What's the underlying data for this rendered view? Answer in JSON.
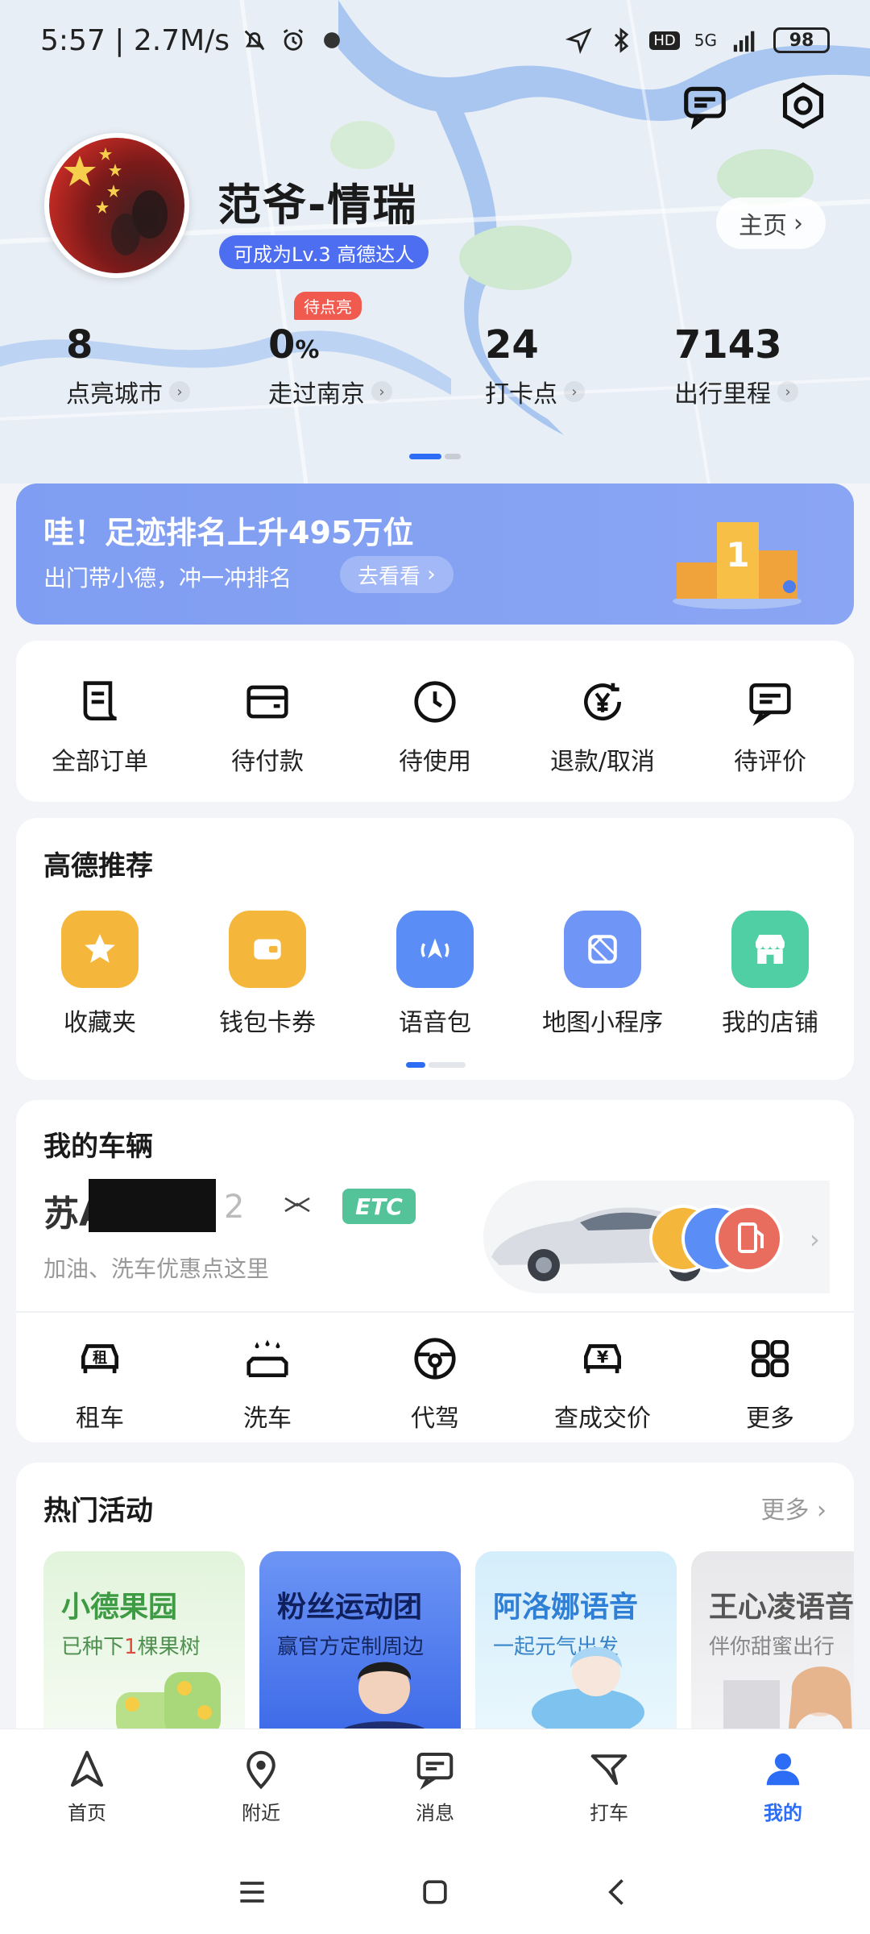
{
  "status_bar": {
    "time_speed": "5:57 | 2.7M/s",
    "network": "5G",
    "hd": "HD",
    "battery": "98"
  },
  "profile": {
    "username": "范爷-情瑞",
    "level_badge": "可成为Lv.3 高德达人",
    "home_button": "主页"
  },
  "stats": [
    {
      "value": "8",
      "unit": "",
      "label": "点亮城市"
    },
    {
      "value": "0",
      "unit": "%",
      "label": "走过南京",
      "tag": "待点亮"
    },
    {
      "value": "24",
      "unit": "",
      "label": "打卡点"
    },
    {
      "value": "7143",
      "unit": "",
      "label": "出行里程"
    }
  ],
  "banner": {
    "title": "哇！足迹排名上升495万位",
    "subtitle": "出门带小德，冲一冲排名",
    "button": "去看看"
  },
  "orders": [
    {
      "label": "全部订单",
      "icon": "order-list-icon"
    },
    {
      "label": "待付款",
      "icon": "wallet-icon"
    },
    {
      "label": "待使用",
      "icon": "clock-icon"
    },
    {
      "label": "退款/取消",
      "icon": "refund-icon"
    },
    {
      "label": "待评价",
      "icon": "comment-icon"
    }
  ],
  "recommend": {
    "title": "高德推荐",
    "items": [
      {
        "label": "收藏夹",
        "icon": "star-icon",
        "color": "#f5b73b"
      },
      {
        "label": "钱包卡券",
        "icon": "wallet-card-icon",
        "color": "#f5b73b"
      },
      {
        "label": "语音包",
        "icon": "voice-navigation-icon",
        "color": "#5b8df6"
      },
      {
        "label": "地图小程序",
        "icon": "map-miniprogram-icon",
        "color": "#6f95f6"
      },
      {
        "label": "我的店铺",
        "icon": "store-icon",
        "color": "#4fcfa3"
      }
    ]
  },
  "vehicle": {
    "title": "我的车辆",
    "plate_prefix": "苏A",
    "plate_suffix": "2",
    "etc": "ETC",
    "subtitle": "加油、洗车优惠点这里",
    "services": [
      {
        "label": "租车",
        "icon": "rent-car-icon"
      },
      {
        "label": "洗车",
        "icon": "car-wash-icon"
      },
      {
        "label": "代驾",
        "icon": "steering-wheel-icon"
      },
      {
        "label": "查成交价",
        "icon": "car-price-icon"
      },
      {
        "label": "更多",
        "icon": "grid-more-icon"
      }
    ]
  },
  "activities": {
    "title": "热门活动",
    "more": "更多",
    "items": [
      {
        "title": "小德果园",
        "subtitle_a": "已种下",
        "subtitle_num": "1",
        "subtitle_b": "棵果树",
        "bg": "#dff2d8",
        "title_color": "#3d9b43"
      },
      {
        "title": "粉丝运动团",
        "subtitle": "赢官方定制周边",
        "bg": "#4f7cf0",
        "title_color": "#1a2a6b"
      },
      {
        "title": "阿洛娜语音",
        "subtitle": "一起元气出发",
        "bg": "#d9f0fb",
        "title_color": "#2f7fd6"
      },
      {
        "title": "王心凌语音",
        "subtitle": "伴你甜蜜出行",
        "bg": "#e9e9ec",
        "title_color": "#555"
      }
    ]
  },
  "bottom_nav": [
    {
      "label": "首页",
      "icon": "navigation-arrow-icon",
      "active": false
    },
    {
      "label": "附近",
      "icon": "location-pin-icon",
      "active": false
    },
    {
      "label": "消息",
      "icon": "message-icon",
      "active": false
    },
    {
      "label": "打车",
      "icon": "taxi-icon",
      "active": false
    },
    {
      "label": "我的",
      "icon": "user-icon",
      "active": true
    }
  ]
}
